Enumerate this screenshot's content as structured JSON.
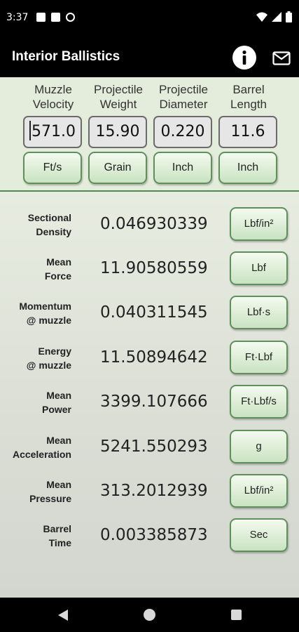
{
  "status_bar": {
    "time": "3:37"
  },
  "app_bar": {
    "title": "Interior Ballistics"
  },
  "inputs": [
    {
      "label": "Muzzle Velocity",
      "value": "571.0",
      "unit": "Ft/s"
    },
    {
      "label": "Projectile Weight",
      "value": "15.90",
      "unit": "Grain"
    },
    {
      "label": "Projectile Diameter",
      "value": "0.220",
      "unit": "Inch"
    },
    {
      "label": "Barrel Length",
      "value": "11.6",
      "unit": "Inch"
    }
  ],
  "results": [
    {
      "label_1": "Sectional",
      "label_2": "Density",
      "value": "0.046930339",
      "unit": "Lbf/in²"
    },
    {
      "label_1": "Mean",
      "label_2": "Force",
      "value": "11.90580559",
      "unit": "Lbf"
    },
    {
      "label_1": "Momentum",
      "label_2": "@ muzzle",
      "value": "0.040311545",
      "unit": "Lbf·s"
    },
    {
      "label_1": "Energy",
      "label_2": "@ muzzle",
      "value": "11.50894642",
      "unit": "Ft·Lbf"
    },
    {
      "label_1": "Mean",
      "label_2": "Power",
      "value": "3399.107666",
      "unit": "Ft·Lbf/s"
    },
    {
      "label_1": "Mean",
      "label_2": "Acceleration",
      "value": "5241.550293",
      "unit": "g"
    },
    {
      "label_1": "Mean",
      "label_2": "Pressure",
      "value": "313.2012939",
      "unit": "Lbf/in²"
    },
    {
      "label_1": "Barrel",
      "label_2": "Time",
      "value": "0.003385873",
      "unit": "Sec"
    }
  ],
  "colors": {
    "accent_green": "#4e8a52",
    "button_green_light": "#f4faef",
    "button_green_dark": "#c9e3c1",
    "bar_black": "#000000"
  }
}
